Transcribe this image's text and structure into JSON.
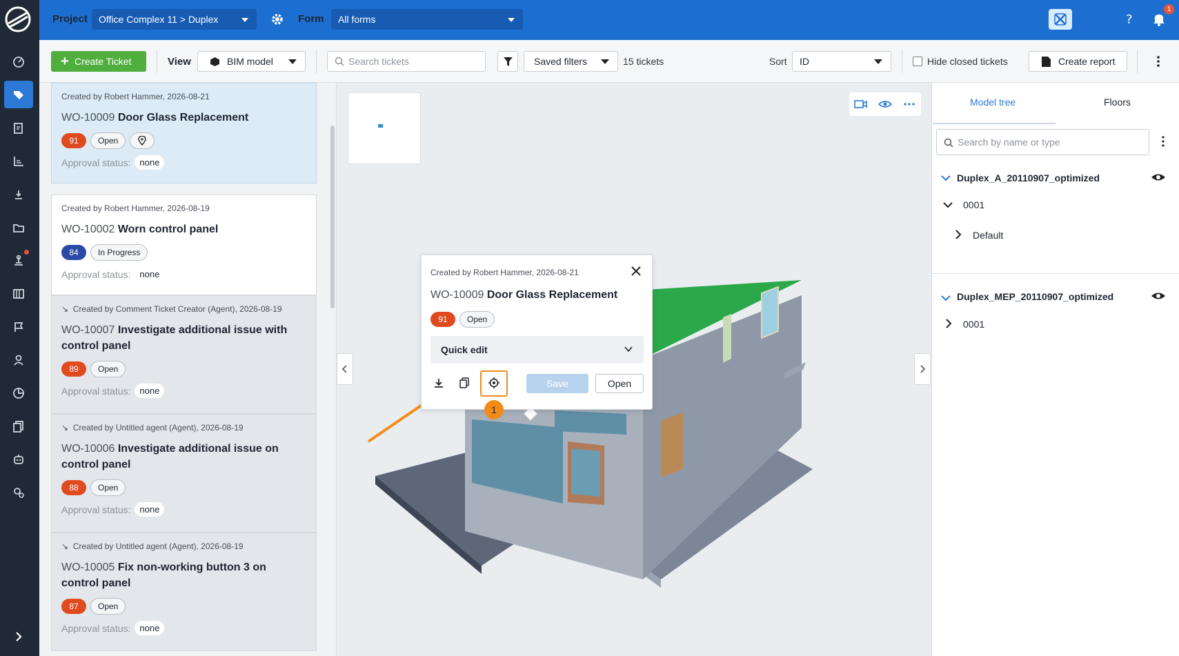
{
  "header": {
    "project_label": "Project",
    "project_value": "Office Complex 11 > Duplex",
    "form_label": "Form",
    "form_value": "All forms",
    "notification_count": "1"
  },
  "toolbar": {
    "create_ticket": "Create Ticket",
    "view_label": "View",
    "view_value": "BIM model",
    "search_placeholder": "Search tickets",
    "saved_filters": "Saved filters",
    "ticket_count": "15 tickets",
    "sort_label": "Sort",
    "sort_value": "ID",
    "hide_closed": "Hide closed tickets",
    "create_report": "Create report"
  },
  "tickets": [
    {
      "meta": "Created by Robert Hammer, 2026-08-21",
      "wo": "WO-10009",
      "title": "Door Glass Replacement",
      "priority": "91",
      "priority_color": "#e04a1f",
      "status": "Open",
      "approval_label": "Approval status:",
      "approval": "none"
    },
    {
      "meta": "Created by Robert Hammer, 2026-08-19",
      "wo": "WO-10002",
      "title": "Worn control panel",
      "priority": "84",
      "priority_color": "#2a4aa8",
      "status": "In Progress",
      "approval_label": "Approval status:",
      "approval": "none"
    },
    {
      "meta": "Created by Comment Ticket Creator (Agent), 2026-08-19",
      "wo": "WO-10007",
      "title": "Investigate additional issue with control panel",
      "priority": "89",
      "priority_color": "#e04a1f",
      "status": "Open",
      "approval_label": "Approval status:",
      "approval": "none"
    },
    {
      "meta": "Created by Untitled agent (Agent), 2026-08-19",
      "wo": "WO-10006",
      "title": "Investigate additional issue on control panel",
      "priority": "88",
      "priority_color": "#e04a1f",
      "status": "Open",
      "approval_label": "Approval status:",
      "approval": "none"
    },
    {
      "meta": "Created by Untitled agent (Agent), 2026-08-19",
      "wo": "WO-10005",
      "title": "Fix non-working button 3 on control panel",
      "priority": "87",
      "priority_color": "#e04a1f",
      "status": "Open",
      "approval_label": "Approval status:",
      "approval": "none"
    }
  ],
  "popup": {
    "meta": "Created by Robert Hammer, 2026-08-21",
    "wo": "WO-10009",
    "title": "Door Glass Replacement",
    "priority": "91",
    "status": "Open",
    "quick_edit": "Quick edit",
    "save": "Save",
    "open": "Open",
    "step": "1"
  },
  "right_panel": {
    "tab_model_tree": "Model tree",
    "tab_floors": "Floors",
    "search_placeholder": "Search by name or type",
    "model_a": "Duplex_A_20110907_optimized",
    "model_a_level": "0001",
    "model_a_sub": "Default",
    "model_mep": "Duplex_MEP_20110907_optimized",
    "model_mep_level": "0001"
  },
  "colors": {
    "accent": "#1c6fd1",
    "create": "#4fae3d",
    "highlight": "#f28b1a"
  }
}
